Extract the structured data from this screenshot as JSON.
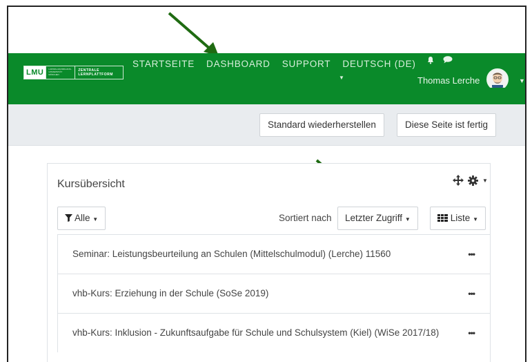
{
  "nav": {
    "logo": {
      "wordmark": "LMU",
      "small_text": "LUDWIG-MAXIMILIANS-UNIVERSITÄT MÜNCHEN",
      "platform": "ZENTRALE LERNPLATTFORM"
    },
    "links": [
      "STARTSEITE",
      "DASHBOARD",
      "SUPPORT",
      "DEUTSCH (DE)"
    ],
    "user_name": "Thomas Lerche"
  },
  "toolbar": {
    "reset_label": "Standard wiederherstellen",
    "done_label": "Diese Seite ist fertig"
  },
  "course_overview": {
    "title": "Kursübersicht",
    "filter_label": "Alle",
    "sort_prefix": "Sortiert nach",
    "sort_value": "Letzter Zugriff",
    "view_label": "Liste",
    "courses": [
      {
        "name": "Seminar: Leistungsbeurteilung an Schulen (Mittelschulmodul) (Lerche) 11560"
      },
      {
        "name": "vhb-Kurs: Erziehung in der Schule (SoSe 2019)"
      },
      {
        "name": "vhb-Kurs: Inklusion - Zukunftsaufgabe für Schule und Schulsystem (Kiel) (WiSe 2017/18)"
      }
    ]
  },
  "colors": {
    "brand_green": "#0a8a2a",
    "annotation_arrow": "#1f6b12",
    "toolbar_bg": "#e9ecef"
  },
  "icons": [
    "bell-icon",
    "chat-icon",
    "move-icon",
    "gear-icon",
    "filter-icon",
    "grid-icon",
    "more-icon",
    "caret-down-icon"
  ]
}
